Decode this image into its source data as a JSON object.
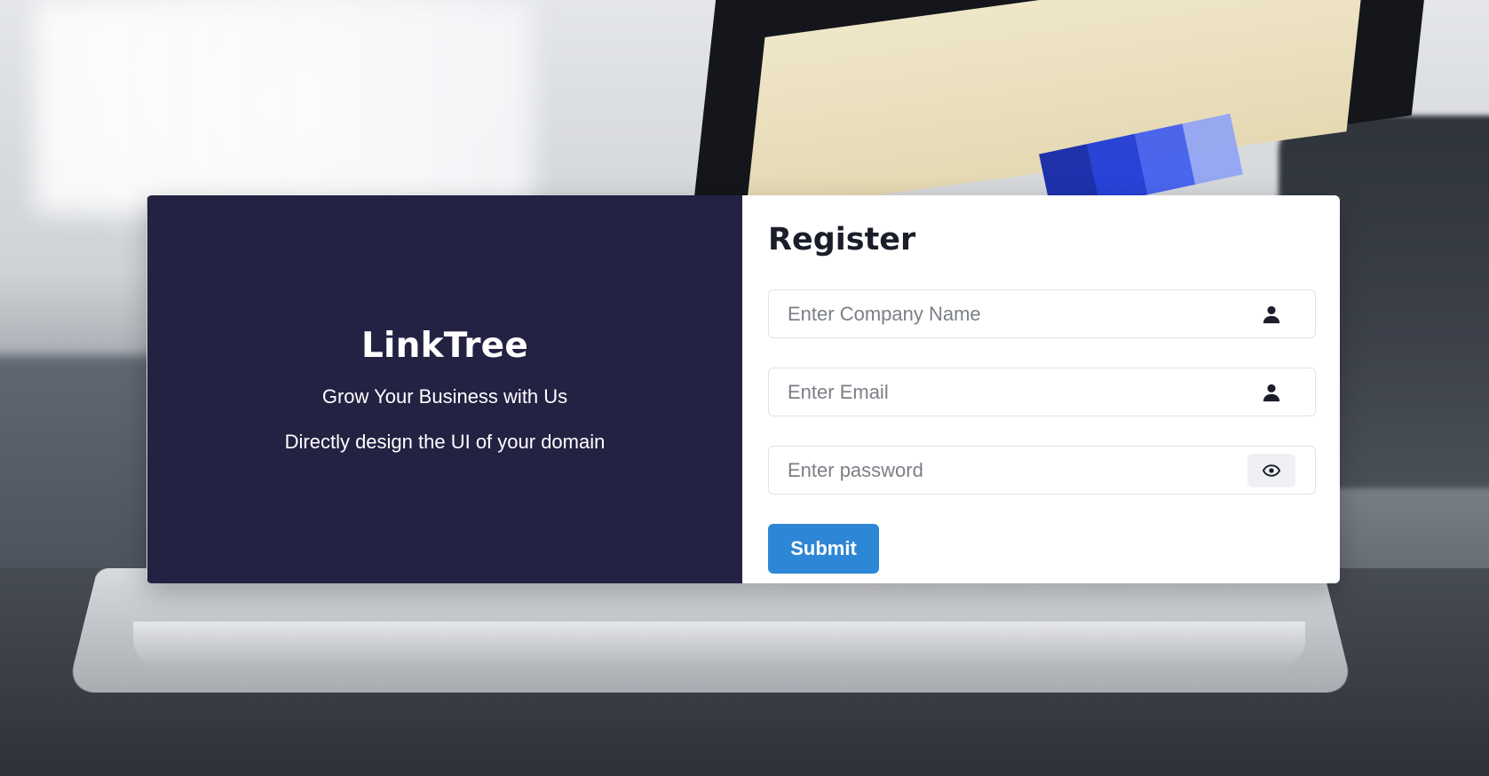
{
  "brand": {
    "title": "LinkTree",
    "tagline": "Grow Your Business with Us",
    "description": "Directly design the UI of your domain"
  },
  "form": {
    "title": "Register",
    "fields": {
      "company": {
        "placeholder": "Enter Company Name",
        "value": "",
        "icon": "user-icon"
      },
      "email": {
        "placeholder": "Enter Email",
        "value": "",
        "icon": "user-icon"
      },
      "password": {
        "placeholder": "Enter password",
        "value": "",
        "icon": "eye-icon"
      }
    },
    "submit_label": "Submit"
  },
  "colors": {
    "brand_panel_bg": "#242243",
    "submit_button": "#2e86d6",
    "title_text": "#1b1e2a"
  }
}
